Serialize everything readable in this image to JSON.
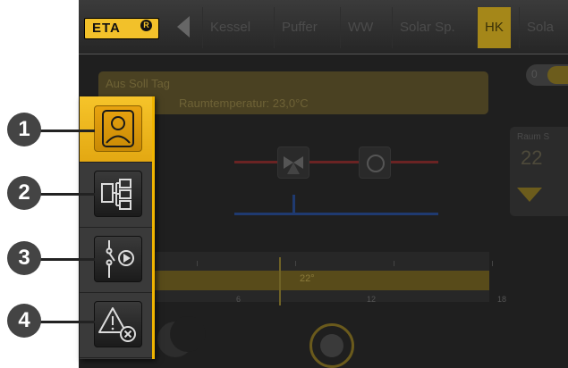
{
  "header": {
    "logo_text": "ETA",
    "logo_mark": "R",
    "tabs": [
      {
        "label": "Kessel",
        "active": false
      },
      {
        "label": "Puffer",
        "active": false
      },
      {
        "label": "WW",
        "active": false
      },
      {
        "label": "Solar Sp.",
        "active": false
      },
      {
        "label": "HK",
        "active": true
      },
      {
        "label": "Sola",
        "active": false
      }
    ]
  },
  "info": {
    "line1": "Aus Soll Tag",
    "line2": "Raumtemperatur: 23,0°C"
  },
  "toggle": {
    "state_label": "0"
  },
  "room_card": {
    "label": "Raum S",
    "value": "22"
  },
  "timeline": {
    "bar_value": "22°",
    "tick_labels": [
      "6",
      "12",
      "18"
    ]
  },
  "side_panel": {
    "buttons": [
      {
        "icon": "user-icon",
        "active": true
      },
      {
        "icon": "overview-tree-icon",
        "active": false
      },
      {
        "icon": "valve-pump-icon",
        "active": false
      },
      {
        "icon": "warning-cancel-icon",
        "active": false
      }
    ]
  },
  "callouts": [
    "1",
    "2",
    "3",
    "4"
  ],
  "colors": {
    "accent": "#f0b400",
    "screen_bg": "#1f1f1f",
    "panel_bg": "#3a3a3a"
  }
}
